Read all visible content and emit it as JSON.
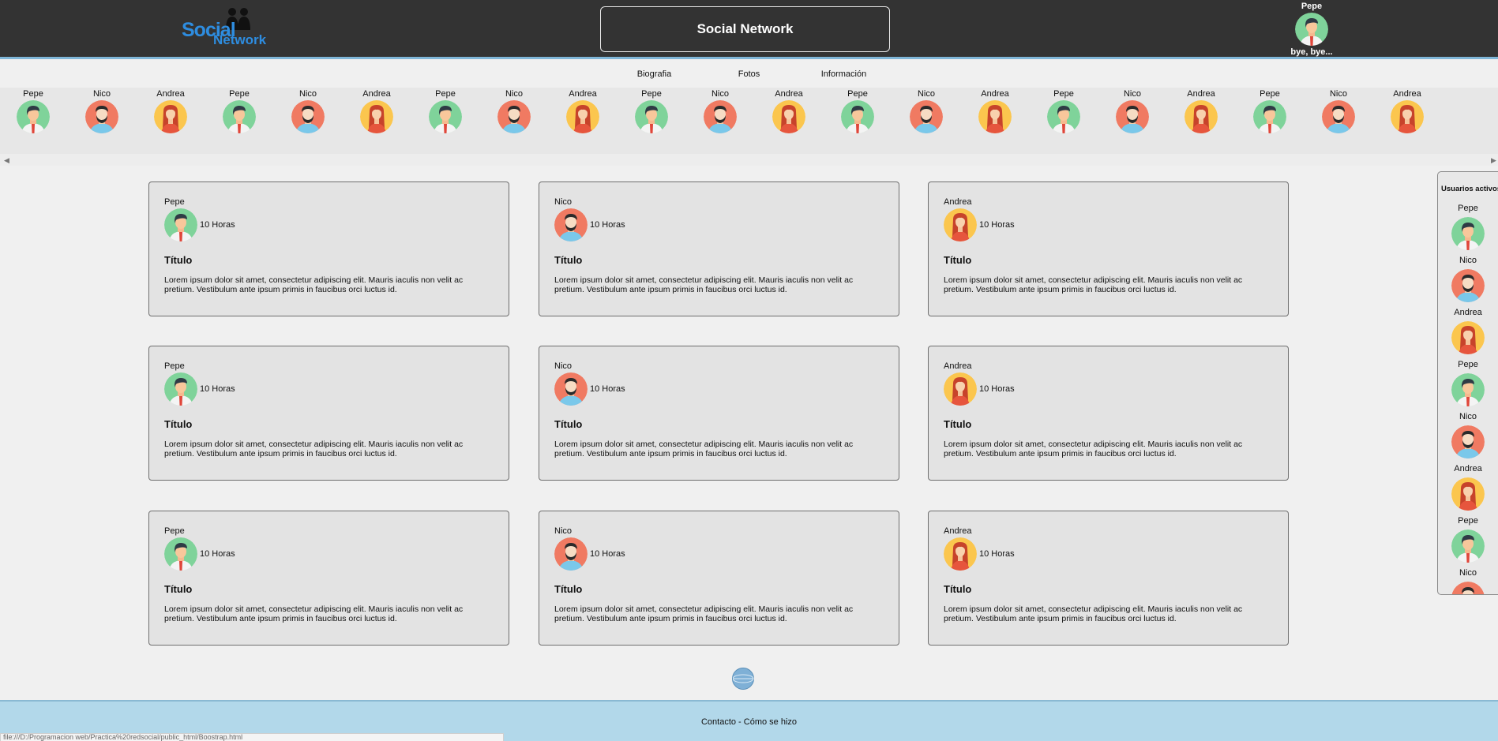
{
  "header": {
    "logo_word1": "Social",
    "logo_word2": "Network",
    "title": "Social Network",
    "user": {
      "name": "Pepe",
      "avatar": "pepe",
      "logout": "bye, bye..."
    }
  },
  "nav": [
    "Biografia",
    "Fotos",
    "Información"
  ],
  "friends": [
    {
      "name": "Pepe",
      "avatar": "pepe"
    },
    {
      "name": "Nico",
      "avatar": "nico"
    },
    {
      "name": "Andrea",
      "avatar": "andrea"
    },
    {
      "name": "Pepe",
      "avatar": "pepe"
    },
    {
      "name": "Nico",
      "avatar": "nico"
    },
    {
      "name": "Andrea",
      "avatar": "andrea"
    },
    {
      "name": "Pepe",
      "avatar": "pepe"
    },
    {
      "name": "Nico",
      "avatar": "nico"
    },
    {
      "name": "Andrea",
      "avatar": "andrea"
    },
    {
      "name": "Pepe",
      "avatar": "pepe"
    },
    {
      "name": "Nico",
      "avatar": "nico"
    },
    {
      "name": "Andrea",
      "avatar": "andrea"
    },
    {
      "name": "Pepe",
      "avatar": "pepe"
    },
    {
      "name": "Nico",
      "avatar": "nico"
    },
    {
      "name": "Andrea",
      "avatar": "andrea"
    },
    {
      "name": "Pepe",
      "avatar": "pepe"
    },
    {
      "name": "Nico",
      "avatar": "nico"
    },
    {
      "name": "Andrea",
      "avatar": "andrea"
    },
    {
      "name": "Pepe",
      "avatar": "pepe"
    },
    {
      "name": "Nico",
      "avatar": "nico"
    },
    {
      "name": "Andrea",
      "avatar": "andrea"
    }
  ],
  "posts": [
    {
      "author": "Pepe",
      "avatar": "pepe",
      "time": "10 Horas",
      "title": "Título",
      "body": "Lorem ipsum dolor sit amet, consectetur adipiscing elit. Mauris iaculis non velit ac pretium. Vestibulum ante ipsum primis in faucibus orci luctus id."
    },
    {
      "author": "Nico",
      "avatar": "nico",
      "time": "10 Horas",
      "title": "Título",
      "body": "Lorem ipsum dolor sit amet, consectetur adipiscing elit. Mauris iaculis non velit ac pretium. Vestibulum ante ipsum primis in faucibus orci luctus id."
    },
    {
      "author": "Andrea",
      "avatar": "andrea",
      "time": "10 Horas",
      "title": "Título",
      "body": "Lorem ipsum dolor sit amet, consectetur adipiscing elit. Mauris iaculis non velit ac pretium. Vestibulum ante ipsum primis in faucibus orci luctus id."
    },
    {
      "author": "Pepe",
      "avatar": "pepe",
      "time": "10 Horas",
      "title": "Título",
      "body": "Lorem ipsum dolor sit amet, consectetur adipiscing elit. Mauris iaculis non velit ac pretium. Vestibulum ante ipsum primis in faucibus orci luctus id."
    },
    {
      "author": "Nico",
      "avatar": "nico",
      "time": "10 Horas",
      "title": "Título",
      "body": "Lorem ipsum dolor sit amet, consectetur adipiscing elit. Mauris iaculis non velit ac pretium. Vestibulum ante ipsum primis in faucibus orci luctus id."
    },
    {
      "author": "Andrea",
      "avatar": "andrea",
      "time": "10 Horas",
      "title": "Título",
      "body": "Lorem ipsum dolor sit amet, consectetur adipiscing elit. Mauris iaculis non velit ac pretium. Vestibulum ante ipsum primis in faucibus orci luctus id."
    },
    {
      "author": "Pepe",
      "avatar": "pepe",
      "time": "10 Horas",
      "title": "Título",
      "body": "Lorem ipsum dolor sit amet, consectetur adipiscing elit. Mauris iaculis non velit ac pretium. Vestibulum ante ipsum primis in faucibus orci luctus id."
    },
    {
      "author": "Nico",
      "avatar": "nico",
      "time": "10 Horas",
      "title": "Título",
      "body": "Lorem ipsum dolor sit amet, consectetur adipiscing elit. Mauris iaculis non velit ac pretium. Vestibulum ante ipsum primis in faucibus orci luctus id."
    },
    {
      "author": "Andrea",
      "avatar": "andrea",
      "time": "10 Horas",
      "title": "Título",
      "body": "Lorem ipsum dolor sit amet, consectetur adipiscing elit. Mauris iaculis non velit ac pretium. Vestibulum ante ipsum primis in faucibus orci luctus id."
    }
  ],
  "active_users": {
    "heading": "Usuarios activos:",
    "users": [
      {
        "name": "Pepe",
        "avatar": "pepe"
      },
      {
        "name": "Nico",
        "avatar": "nico"
      },
      {
        "name": "Andrea",
        "avatar": "andrea"
      },
      {
        "name": "Pepe",
        "avatar": "pepe"
      },
      {
        "name": "Nico",
        "avatar": "nico"
      },
      {
        "name": "Andrea",
        "avatar": "andrea"
      },
      {
        "name": "Pepe",
        "avatar": "pepe"
      },
      {
        "name": "Nico",
        "avatar": "nico"
      }
    ]
  },
  "footer": {
    "text": "Contacto - Cómo se hizo"
  },
  "statusbar": {
    "text": "file:///D:/Programacion web/Practica%20redsocial/public_html/Boostrap.html"
  },
  "colors": {
    "header_bg": "#333333",
    "pepe_bg": "#7fd39a",
    "nico_bg": "#f07a62",
    "andrea_bg": "#fbc64e",
    "footer_bg": "#b2d8ea",
    "logo_blue": "#2e8de0"
  },
  "icons": {
    "pepe": "pepe-avatar-icon",
    "nico": "nico-avatar-icon",
    "andrea": "andrea-avatar-icon",
    "scroll_left": "scroll-left-arrow-icon",
    "scroll_right": "scroll-right-arrow-icon",
    "globe": "globe-icon"
  }
}
